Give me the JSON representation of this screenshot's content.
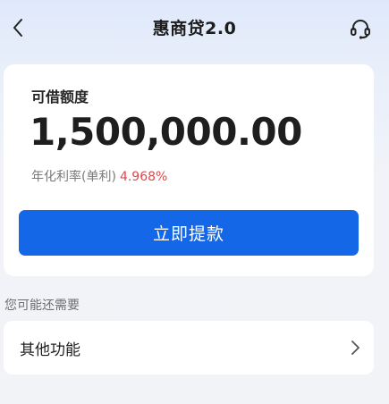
{
  "header": {
    "title": "惠商贷2.0",
    "back_icon": "chevron-left-icon",
    "service_icon": "headset-icon"
  },
  "credit_card": {
    "label": "可借额度",
    "amount": "1,500,000.00",
    "rate_label": "年化利率(单利)",
    "rate_value": "4.968%",
    "withdraw_button": "立即提款"
  },
  "suggestions": {
    "section_title": "您可能还需要",
    "items": [
      {
        "label": "其他功能",
        "icon": "chevron-right-icon"
      }
    ]
  },
  "colors": {
    "accent": "#1467e6",
    "rate": "#e0484a",
    "background": "#f2f3f7"
  }
}
